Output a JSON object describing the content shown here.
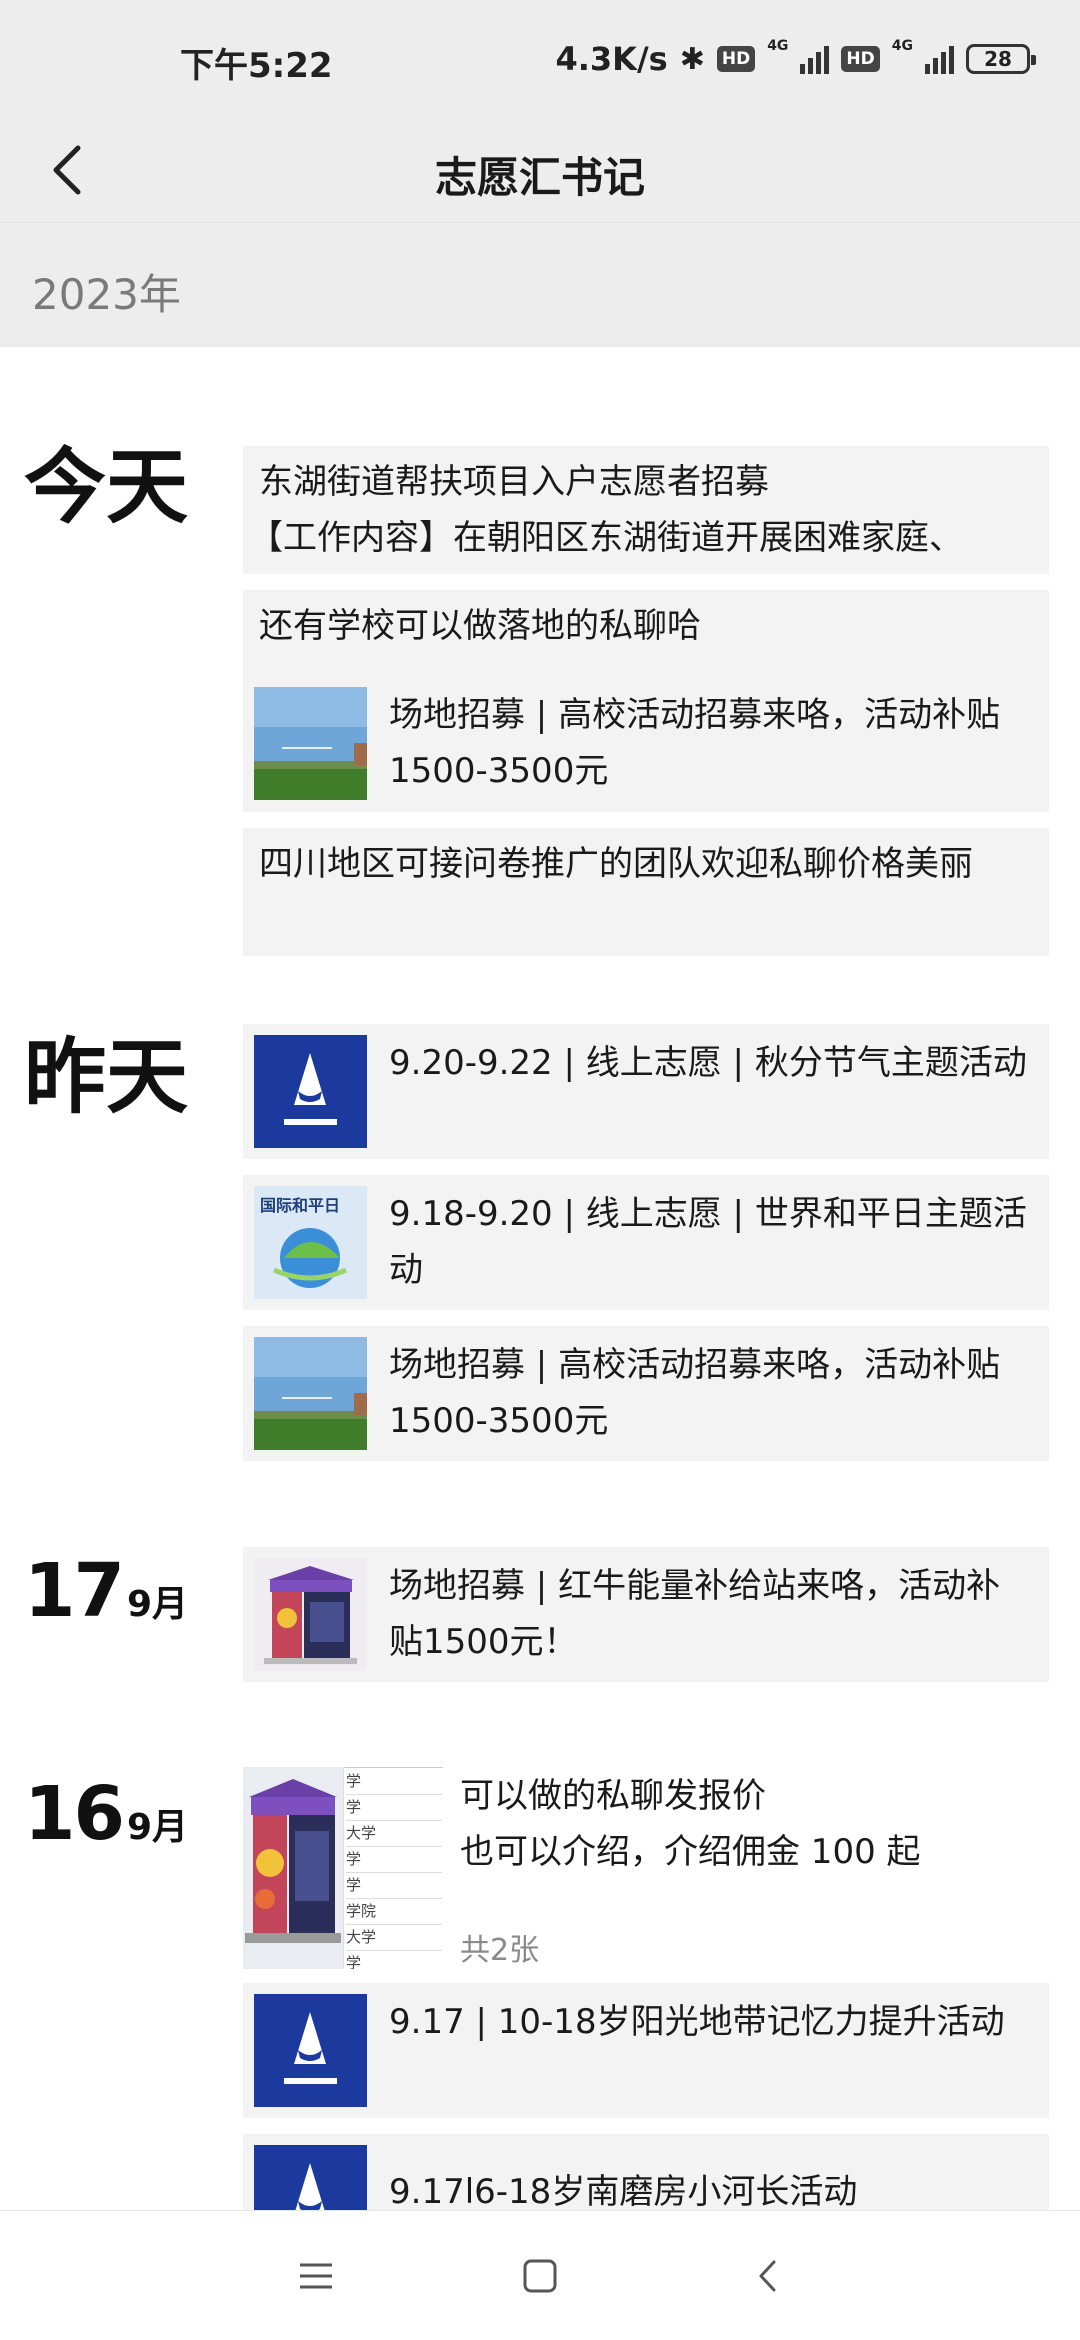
{
  "status_bar": {
    "time": "下午5:22",
    "speed": "4.3K/s",
    "hd": "HD",
    "network": "4G",
    "battery": "28"
  },
  "app_bar": {
    "title": "志愿汇书记"
  },
  "year": "2023年",
  "groups": {
    "today": {
      "date": "今天",
      "posts": [
        {
          "line1": "东湖街道帮扶项目入户志愿者招募",
          "line2": "【工作内容】在朝阳区东湖街道开展困难家庭、"
        },
        {
          "caption": "还有学校可以做落地的私聊哈",
          "link_title": "场地招募 | 高校活动招募来咯，活动补贴1500-3500元",
          "thumb": "campus-photo"
        },
        {
          "text": "四川地区可接问卷推广的团队欢迎私聊价格美丽"
        }
      ]
    },
    "yesterday": {
      "date": "昨天",
      "posts": [
        {
          "link_title": "9.20-9.22 | 线上志愿 | 秋分节气主题活动",
          "thumb": "shark-logo"
        },
        {
          "link_title": "9.18-9.20 | 线上志愿 | 世界和平日主题活动",
          "thumb": "peace-day-poster",
          "thumb_text": "国际和平日"
        },
        {
          "link_title": "场地招募 | 高校活动招募来咯，活动补贴1500-3500元",
          "thumb": "campus-photo"
        }
      ]
    },
    "sep17": {
      "day": "17",
      "month": "9月",
      "posts": [
        {
          "link_title": "场地招募 | 红牛能量补给站来咯，活动补贴1500元！",
          "thumb": "booth-photo"
        }
      ]
    },
    "sep16": {
      "day": "16",
      "month": "9月",
      "posts": [
        {
          "line1": "可以做的私聊发报价",
          "line2": "也可以介绍，介绍佣金 100 起",
          "count": "共2张",
          "thumb": "booth-and-list"
        },
        {
          "link_title": "9.17 | 10-18岁阳光地带记忆力提升活动",
          "thumb": "shark-logo"
        },
        {
          "link_title": "9.17l6-18岁南磨房小河长活动",
          "thumb": "shark-logo"
        }
      ]
    }
  },
  "list_sheet_text": [
    "学",
    "学",
    "大学",
    "学",
    "学",
    "学院",
    "大学",
    "学"
  ],
  "nav": {
    "menu": "menu-icon",
    "home": "home-icon",
    "back": "back-icon"
  },
  "colors": {
    "bar_bg": "#ededed",
    "card_bg": "#f3f3f3",
    "shark_blue": "#1c3a9e"
  }
}
